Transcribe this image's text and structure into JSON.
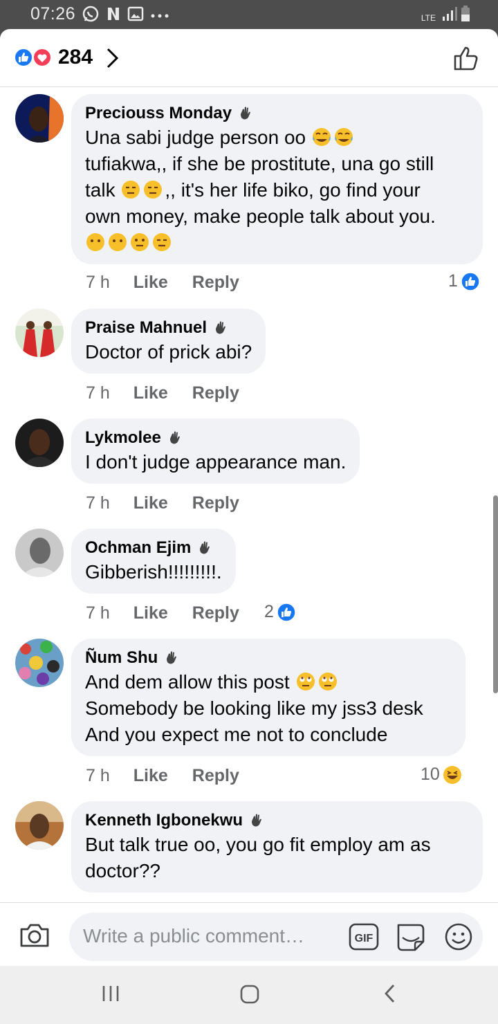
{
  "status_bar": {
    "time": "07:26",
    "network": "LTE"
  },
  "header": {
    "reaction_count": "284"
  },
  "comments": [
    {
      "author": "Preciouss Monday",
      "lines": [
        "Una sabi judge person oo",
        "tufiakwa,, if she be prostitute, una go still",
        "talk",
        ",, it's her life biko, go find your",
        "own money, make people talk about you."
      ],
      "time": "7 h",
      "like": "Like",
      "reply": "Reply",
      "reactions": "1",
      "reaction_type": "like"
    },
    {
      "author": "Praise Mahnuel",
      "lines": [
        "Doctor of prick abi?"
      ],
      "time": "7 h",
      "like": "Like",
      "reply": "Reply"
    },
    {
      "author": "Lykmolee",
      "lines": [
        "I don't judge appearance man."
      ],
      "time": "7 h",
      "like": "Like",
      "reply": "Reply"
    },
    {
      "author": "Ochman Ejim",
      "lines": [
        "Gibberish!!!!!!!!!."
      ],
      "time": "7 h",
      "like": "Like",
      "reply": "Reply",
      "reactions": "2",
      "reaction_type": "like"
    },
    {
      "author": "Ñum Shu",
      "lines": [
        "And dem allow this post",
        "Somebody be looking like my jss3 desk",
        "And you expect me not to conclude"
      ],
      "time": "7 h",
      "like": "Like",
      "reply": "Reply",
      "reactions": "10",
      "reaction_type": "haha"
    },
    {
      "author": "Kenneth Igbonekwu",
      "lines": [
        "But talk true oo, you go fit employ am as",
        "doctor??"
      ]
    }
  ],
  "composer": {
    "placeholder": "Write a public comment…",
    "gif_label": "GIF"
  },
  "colors": {
    "accent": "#1877f2",
    "bubble": "#f0f2f5",
    "love": "#f33e58"
  },
  "icons": [
    "whatsapp-icon",
    "netflix-icon",
    "gallery-icon",
    "like-icon",
    "love-icon",
    "wave-icon",
    "camera-icon",
    "gif-icon",
    "sticker-icon",
    "smiley-icon"
  ]
}
